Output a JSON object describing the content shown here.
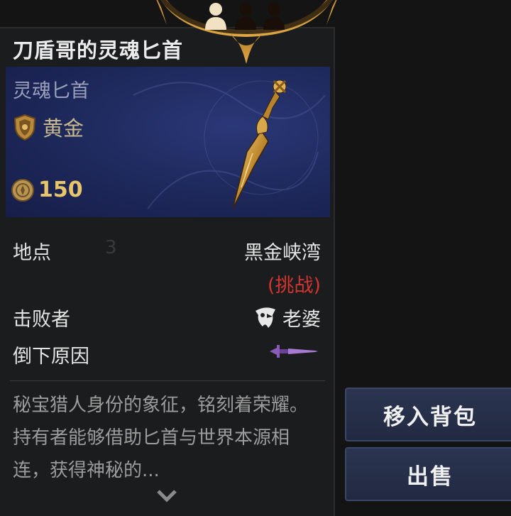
{
  "party": {
    "icons": [
      "player-active-icon",
      "player-inactive-icon",
      "player-inactive-icon"
    ]
  },
  "item": {
    "title": "刀盾哥的灵魂匕首",
    "type": "灵魂匕首",
    "rarity": "黄金",
    "rarity_icon": "gold-shield-icon",
    "price": "150",
    "price_icon": "coin-icon",
    "image": "golden-dagger"
  },
  "info": {
    "location_label": "地点",
    "location_value": "黑金峡湾",
    "location_mode": "(挑战)",
    "faint_number": "3",
    "killer_label": "击败者",
    "killer_value": "老婆",
    "killer_icon": "skull-mask-icon",
    "cause_label": "倒下原因",
    "cause_icon": "purple-dagger-icon"
  },
  "description": "秘宝猎人身份的象征，铭刻着荣耀。持有者能够借助匕首与世界本源相连，获得神秘的...",
  "actions": {
    "move_to_bag": "移入背包",
    "sell": "出售"
  },
  "colors": {
    "accent_gold": "#e8c46b",
    "challenge_red": "#d2352f",
    "panel_blue": "#1f2a5e",
    "button_bg": "#2b3450"
  }
}
